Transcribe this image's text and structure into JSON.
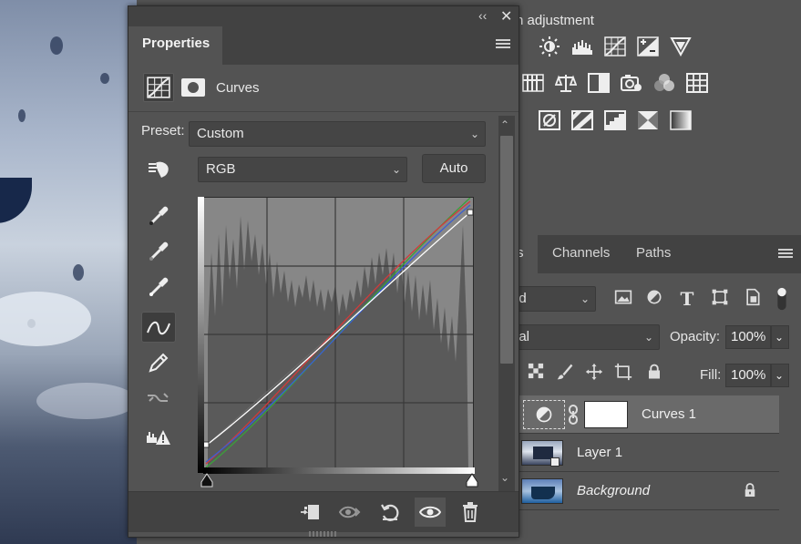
{
  "properties": {
    "tab_label": "Properties",
    "adjustment_name": "Curves",
    "preset_label": "Preset:",
    "preset_value": "Custom",
    "channel_value": "RGB",
    "auto_label": "Auto"
  },
  "adjustments": {
    "title_partial": "n adjustment"
  },
  "layers": {
    "tabs": [
      "rs",
      "Channels",
      "Paths"
    ],
    "kind_filter_partial": "nd",
    "blend_mode_partial": "nal",
    "opacity_label": "Opacity:",
    "opacity_value": "100%",
    "fill_label": "Fill:",
    "fill_value": "100%",
    "rows": [
      {
        "name": "Curves 1",
        "selected": true
      },
      {
        "name": "Layer 1",
        "selected": false
      },
      {
        "name": "Background",
        "selected": false,
        "italic": true,
        "locked": true
      }
    ]
  },
  "colors": {
    "panel_bg": "#535353",
    "panel_dark": "#424242",
    "curve_red": "#d23a3a",
    "curve_green": "#3aa13a",
    "curve_blue": "#3a5ed2",
    "curve_rgb": "#ffffff"
  },
  "icons": {
    "properties_header": [
      "curves-adjustment-icon",
      "layer-mask-icon"
    ],
    "tools": [
      "on-image-adjust-icon",
      "black-point-eyedropper-icon",
      "gray-point-eyedropper-icon",
      "white-point-eyedropper-icon",
      "curve-points-icon",
      "pencil-draw-icon",
      "smooth-curve-icon",
      "clipping-warning-icon"
    ],
    "footer": [
      "clip-to-layer-icon",
      "view-previous-state-icon",
      "reset-adjustments-icon",
      "toggle-visibility-icon",
      "delete-adjustment-icon"
    ]
  }
}
